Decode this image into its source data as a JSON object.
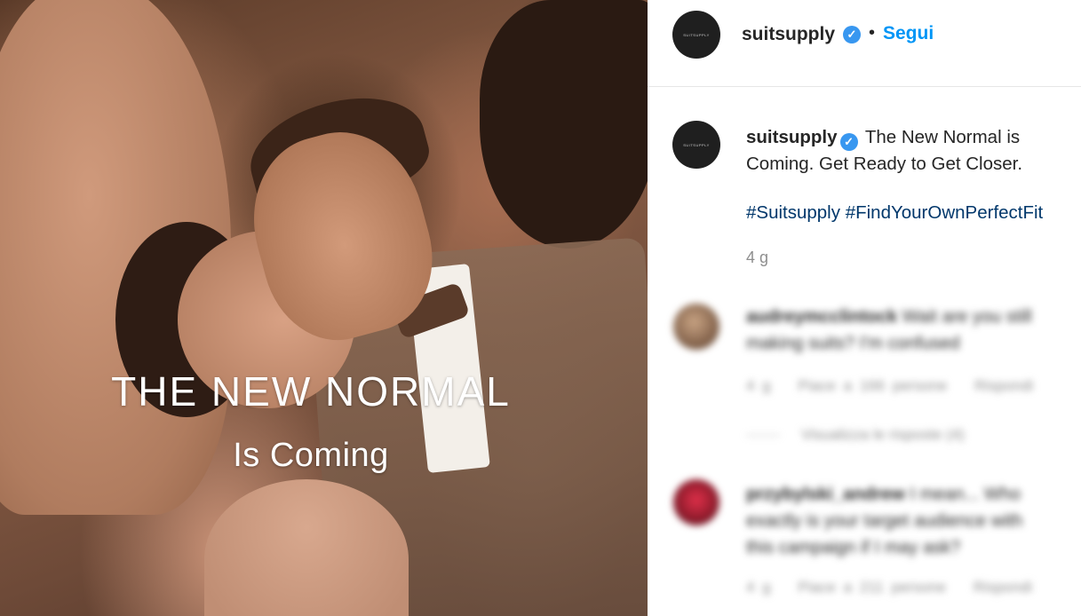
{
  "post": {
    "overlay_title": "THE NEW NORMAL",
    "overlay_subtitle": "Is Coming"
  },
  "header": {
    "avatar_text": "SUITSUPPLY",
    "username": "suitsupply",
    "separator": "•",
    "follow_label": "Segui"
  },
  "caption": {
    "avatar_text": "SUITSUPPLY",
    "username": "suitsupply",
    "text": "The New Normal is Coming. Get Ready to Get Closer.",
    "hashtags": [
      "#Suitsupply",
      "#FindYourOwnPerfectFit"
    ],
    "age": "4 g"
  },
  "comments": [
    {
      "username": "audreymcclintock",
      "text": "Wait are you still making suits? I'm confused",
      "age": "4 g",
      "likes": "Piace a 166 persone",
      "reply_label": "Rispondi",
      "view_replies": "Visualizza le risposte (4)"
    },
    {
      "username": "przybylski_andrew",
      "text": "I mean... Who exactly is your target audience with this campaign if I may ask?",
      "age": "4 g",
      "likes": "Piace a 211 persone",
      "reply_label": "Rispondi"
    }
  ],
  "icons": {
    "verified": "verified-badge-icon"
  },
  "colors": {
    "accent": "#0095f6",
    "verified": "#3897f0",
    "hashtag": "#00376b",
    "muted": "#8e8e8e"
  }
}
